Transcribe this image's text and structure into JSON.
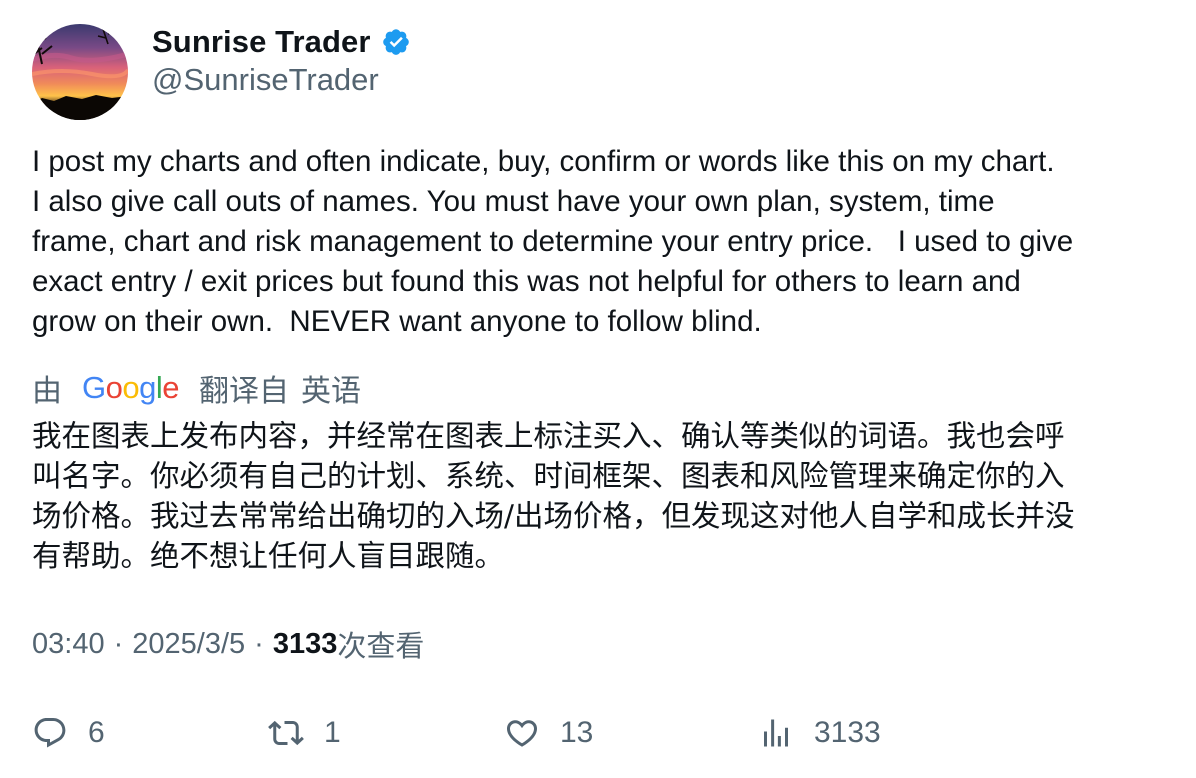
{
  "author": {
    "display_name": "Sunrise Trader",
    "handle": "@SunriseTrader",
    "verified": true,
    "verified_color": "#1d9bf0"
  },
  "tweet": {
    "text_lines": [
      "I post my charts and often indicate, buy, confirm or words like this on my chart.",
      "I also give call outs of names. You must have your own plan, system, time",
      "frame, chart and risk management to determine your entry price.   I used to give",
      "exact entry / exit prices but found this was not helpful for others to learn and",
      "grow on their own.  NEVER want anyone to follow blind."
    ]
  },
  "translation": {
    "by_label": "由",
    "provider": "Google",
    "provider_letters": [
      "G",
      "o",
      "o",
      "g",
      "l",
      "e"
    ],
    "provider_colors": [
      "#4285F4",
      "#EA4335",
      "#FBBC05",
      "#4285F4",
      "#34A853",
      "#EA4335"
    ],
    "translated_from_label": "翻译自",
    "source_language": "英语",
    "text_lines": [
      "我在图表上发布内容，并经常在图表上标注买入、确认等类似的词语。我也会呼",
      "叫名字。你必须有自己的计划、系统、时间框架、图表和风险管理来确定你的入",
      "场价格。我过去常常给出确切的入场/出场价格，但发现这对他人自学和成长并没",
      "有帮助。绝不想让任何人盲目跟随。"
    ]
  },
  "meta": {
    "time": "03:40",
    "date": "2025/3/5",
    "separator": "·",
    "views_count": "3133",
    "views_label": "次查看"
  },
  "actions": {
    "reply": {
      "icon": "reply-icon",
      "count": "6"
    },
    "retweet": {
      "icon": "retweet-icon",
      "count": "1"
    },
    "like": {
      "icon": "heart-icon",
      "count": "13"
    },
    "views": {
      "icon": "analytics-icon",
      "count": "3133"
    }
  }
}
